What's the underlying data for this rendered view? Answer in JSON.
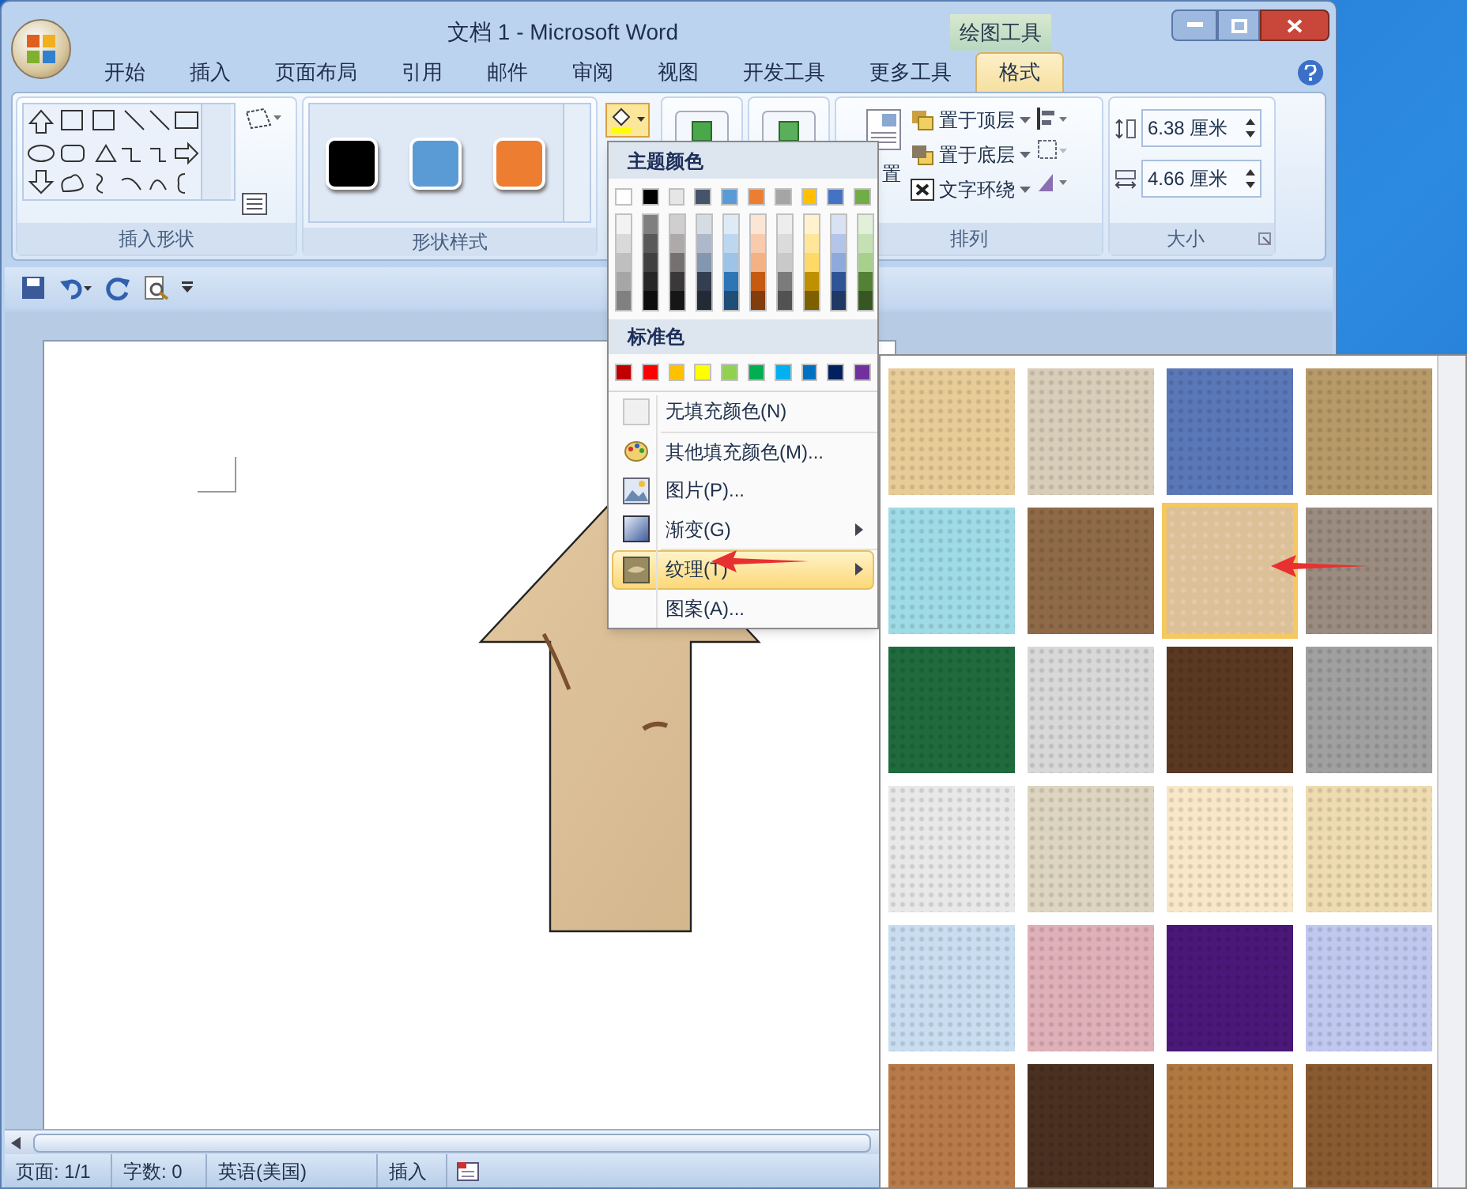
{
  "window": {
    "title": "文档 1 - Microsoft Word",
    "context_tab": "绘图工具"
  },
  "tabs": [
    {
      "label": "开始",
      "selected": false
    },
    {
      "label": "插入",
      "selected": false
    },
    {
      "label": "页面布局",
      "selected": false
    },
    {
      "label": "引用",
      "selected": false
    },
    {
      "label": "邮件",
      "selected": false
    },
    {
      "label": "审阅",
      "selected": false
    },
    {
      "label": "视图",
      "selected": false
    },
    {
      "label": "开发工具",
      "selected": false
    },
    {
      "label": "更多工具",
      "selected": false
    },
    {
      "label": "格式",
      "selected": true
    }
  ],
  "ribbon": {
    "insert_shapes": {
      "label": "插入形状"
    },
    "shape_styles": {
      "label": "形状样式",
      "styles": [
        {
          "color": "#000000"
        },
        {
          "color": "#5b9bd5"
        },
        {
          "color": "#ed7d31"
        }
      ]
    },
    "arrange": {
      "label": "排列",
      "partial_label": "置",
      "items": [
        "置于顶层",
        "置于底层",
        "文字环绕"
      ]
    },
    "size": {
      "label": "大小",
      "height": "6.38 厘米",
      "width": "4.66 厘米"
    }
  },
  "fill_menu": {
    "theme_heading": "主题颜色",
    "theme_colors": [
      {
        "color": "#ffffff",
        "shades": [
          {
            "color": "#f2f2f2"
          },
          {
            "color": "#d9d9d9"
          },
          {
            "color": "#bfbfbf"
          },
          {
            "color": "#a6a6a6"
          },
          {
            "color": "#808080"
          }
        ]
      },
      {
        "color": "#000000",
        "shades": [
          {
            "color": "#7f7f7f"
          },
          {
            "color": "#595959"
          },
          {
            "color": "#404040"
          },
          {
            "color": "#262626"
          },
          {
            "color": "#0d0d0d"
          }
        ]
      },
      {
        "color": "#e7e6e6",
        "shades": [
          {
            "color": "#d0cece"
          },
          {
            "color": "#aeaaaa"
          },
          {
            "color": "#757171"
          },
          {
            "color": "#3a3838"
          },
          {
            "color": "#161616"
          }
        ]
      },
      {
        "color": "#44546a",
        "shades": [
          {
            "color": "#d6dce4"
          },
          {
            "color": "#adb9ca"
          },
          {
            "color": "#8497b0"
          },
          {
            "color": "#333f50"
          },
          {
            "color": "#222a35"
          }
        ]
      },
      {
        "color": "#5b9bd5",
        "shades": [
          {
            "color": "#deebf6"
          },
          {
            "color": "#bdd7ee"
          },
          {
            "color": "#9dc3e6"
          },
          {
            "color": "#2e75b5"
          },
          {
            "color": "#1f4e79"
          }
        ]
      },
      {
        "color": "#ed7d31",
        "shades": [
          {
            "color": "#fbe5d5"
          },
          {
            "color": "#f7cbac"
          },
          {
            "color": "#f4b183"
          },
          {
            "color": "#c55a11"
          },
          {
            "color": "#833c0b"
          }
        ]
      },
      {
        "color": "#a5a5a5",
        "shades": [
          {
            "color": "#ededed"
          },
          {
            "color": "#dbdbdb"
          },
          {
            "color": "#c9c9c9"
          },
          {
            "color": "#7b7b7b"
          },
          {
            "color": "#525252"
          }
        ]
      },
      {
        "color": "#ffc000",
        "shades": [
          {
            "color": "#fff2cc"
          },
          {
            "color": "#ffe699"
          },
          {
            "color": "#ffd965"
          },
          {
            "color": "#bf9000"
          },
          {
            "color": "#7f6000"
          }
        ]
      },
      {
        "color": "#4472c4",
        "shades": [
          {
            "color": "#d9e2f3"
          },
          {
            "color": "#b4c6e7"
          },
          {
            "color": "#8eaadb"
          },
          {
            "color": "#2f5496"
          },
          {
            "color": "#1f3864"
          }
        ]
      },
      {
        "color": "#70ad47",
        "shades": [
          {
            "color": "#e2efd9"
          },
          {
            "color": "#c5e0b3"
          },
          {
            "color": "#a8d08d"
          },
          {
            "color": "#538135"
          },
          {
            "color": "#375623"
          }
        ]
      }
    ],
    "standard_heading": "标准色",
    "standard_colors": [
      {
        "color": "#c00000"
      },
      {
        "color": "#ff0000"
      },
      {
        "color": "#ffc000"
      },
      {
        "color": "#ffff00"
      },
      {
        "color": "#92d050"
      },
      {
        "color": "#00b050"
      },
      {
        "color": "#00b0f0"
      },
      {
        "color": "#0070c0"
      },
      {
        "color": "#002060"
      },
      {
        "color": "#7030a0"
      }
    ],
    "items": [
      {
        "label": "无填充颜色(N)",
        "kind": "none",
        "submenu": false,
        "selected": false
      },
      {
        "label": "其他填充颜色(M)...",
        "kind": "palette",
        "submenu": false,
        "selected": false
      },
      {
        "label": "图片(P)...",
        "kind": "picture",
        "submenu": false,
        "selected": false
      },
      {
        "label": "渐变(G)",
        "kind": "gradient",
        "submenu": true,
        "selected": false
      },
      {
        "label": "纹理(T)",
        "kind": "texture",
        "submenu": true,
        "selected": true
      },
      {
        "label": "图案(A)...",
        "kind": "pattern",
        "submenu": false,
        "selected": false
      }
    ]
  },
  "texture_gallery": {
    "textures": [
      {
        "color": "#e8cc98",
        "selected": false
      },
      {
        "color": "#d8cdb8",
        "selected": false
      },
      {
        "color": "#5a78b8",
        "selected": false
      },
      {
        "color": "#b89a68",
        "selected": false
      },
      {
        "color": "#9fdbe6",
        "selected": false
      },
      {
        "color": "#8f6a48",
        "selected": false
      },
      {
        "color": "#dcc098",
        "selected": true
      },
      {
        "color": "#9a8c80",
        "selected": false
      },
      {
        "color": "#1f6b3d",
        "selected": false
      },
      {
        "color": "#d8d8d8",
        "selected": false
      },
      {
        "color": "#5a3822",
        "selected": false
      },
      {
        "color": "#a0a0a0",
        "selected": false
      },
      {
        "color": "#e8e8e8",
        "selected": false
      },
      {
        "color": "#ddd5c0",
        "selected": false
      },
      {
        "color": "#f8e8c8",
        "selected": false
      },
      {
        "color": "#eedbb0",
        "selected": false
      },
      {
        "color": "#c8ddf0",
        "selected": false
      },
      {
        "color": "#e0b0b8",
        "selected": false
      },
      {
        "color": "#4a1878",
        "selected": false
      },
      {
        "color": "#c0c8f0",
        "selected": false
      },
      {
        "color": "#b87a48",
        "selected": false
      },
      {
        "color": "#4a3020",
        "selected": false
      },
      {
        "color": "#b07840",
        "selected": false
      },
      {
        "color": "#8a5a30",
        "selected": false
      }
    ]
  },
  "status_bar": {
    "page": "页面: 1/1",
    "words": "字数: 0",
    "language": "英语(美国)",
    "mode": "插入"
  }
}
